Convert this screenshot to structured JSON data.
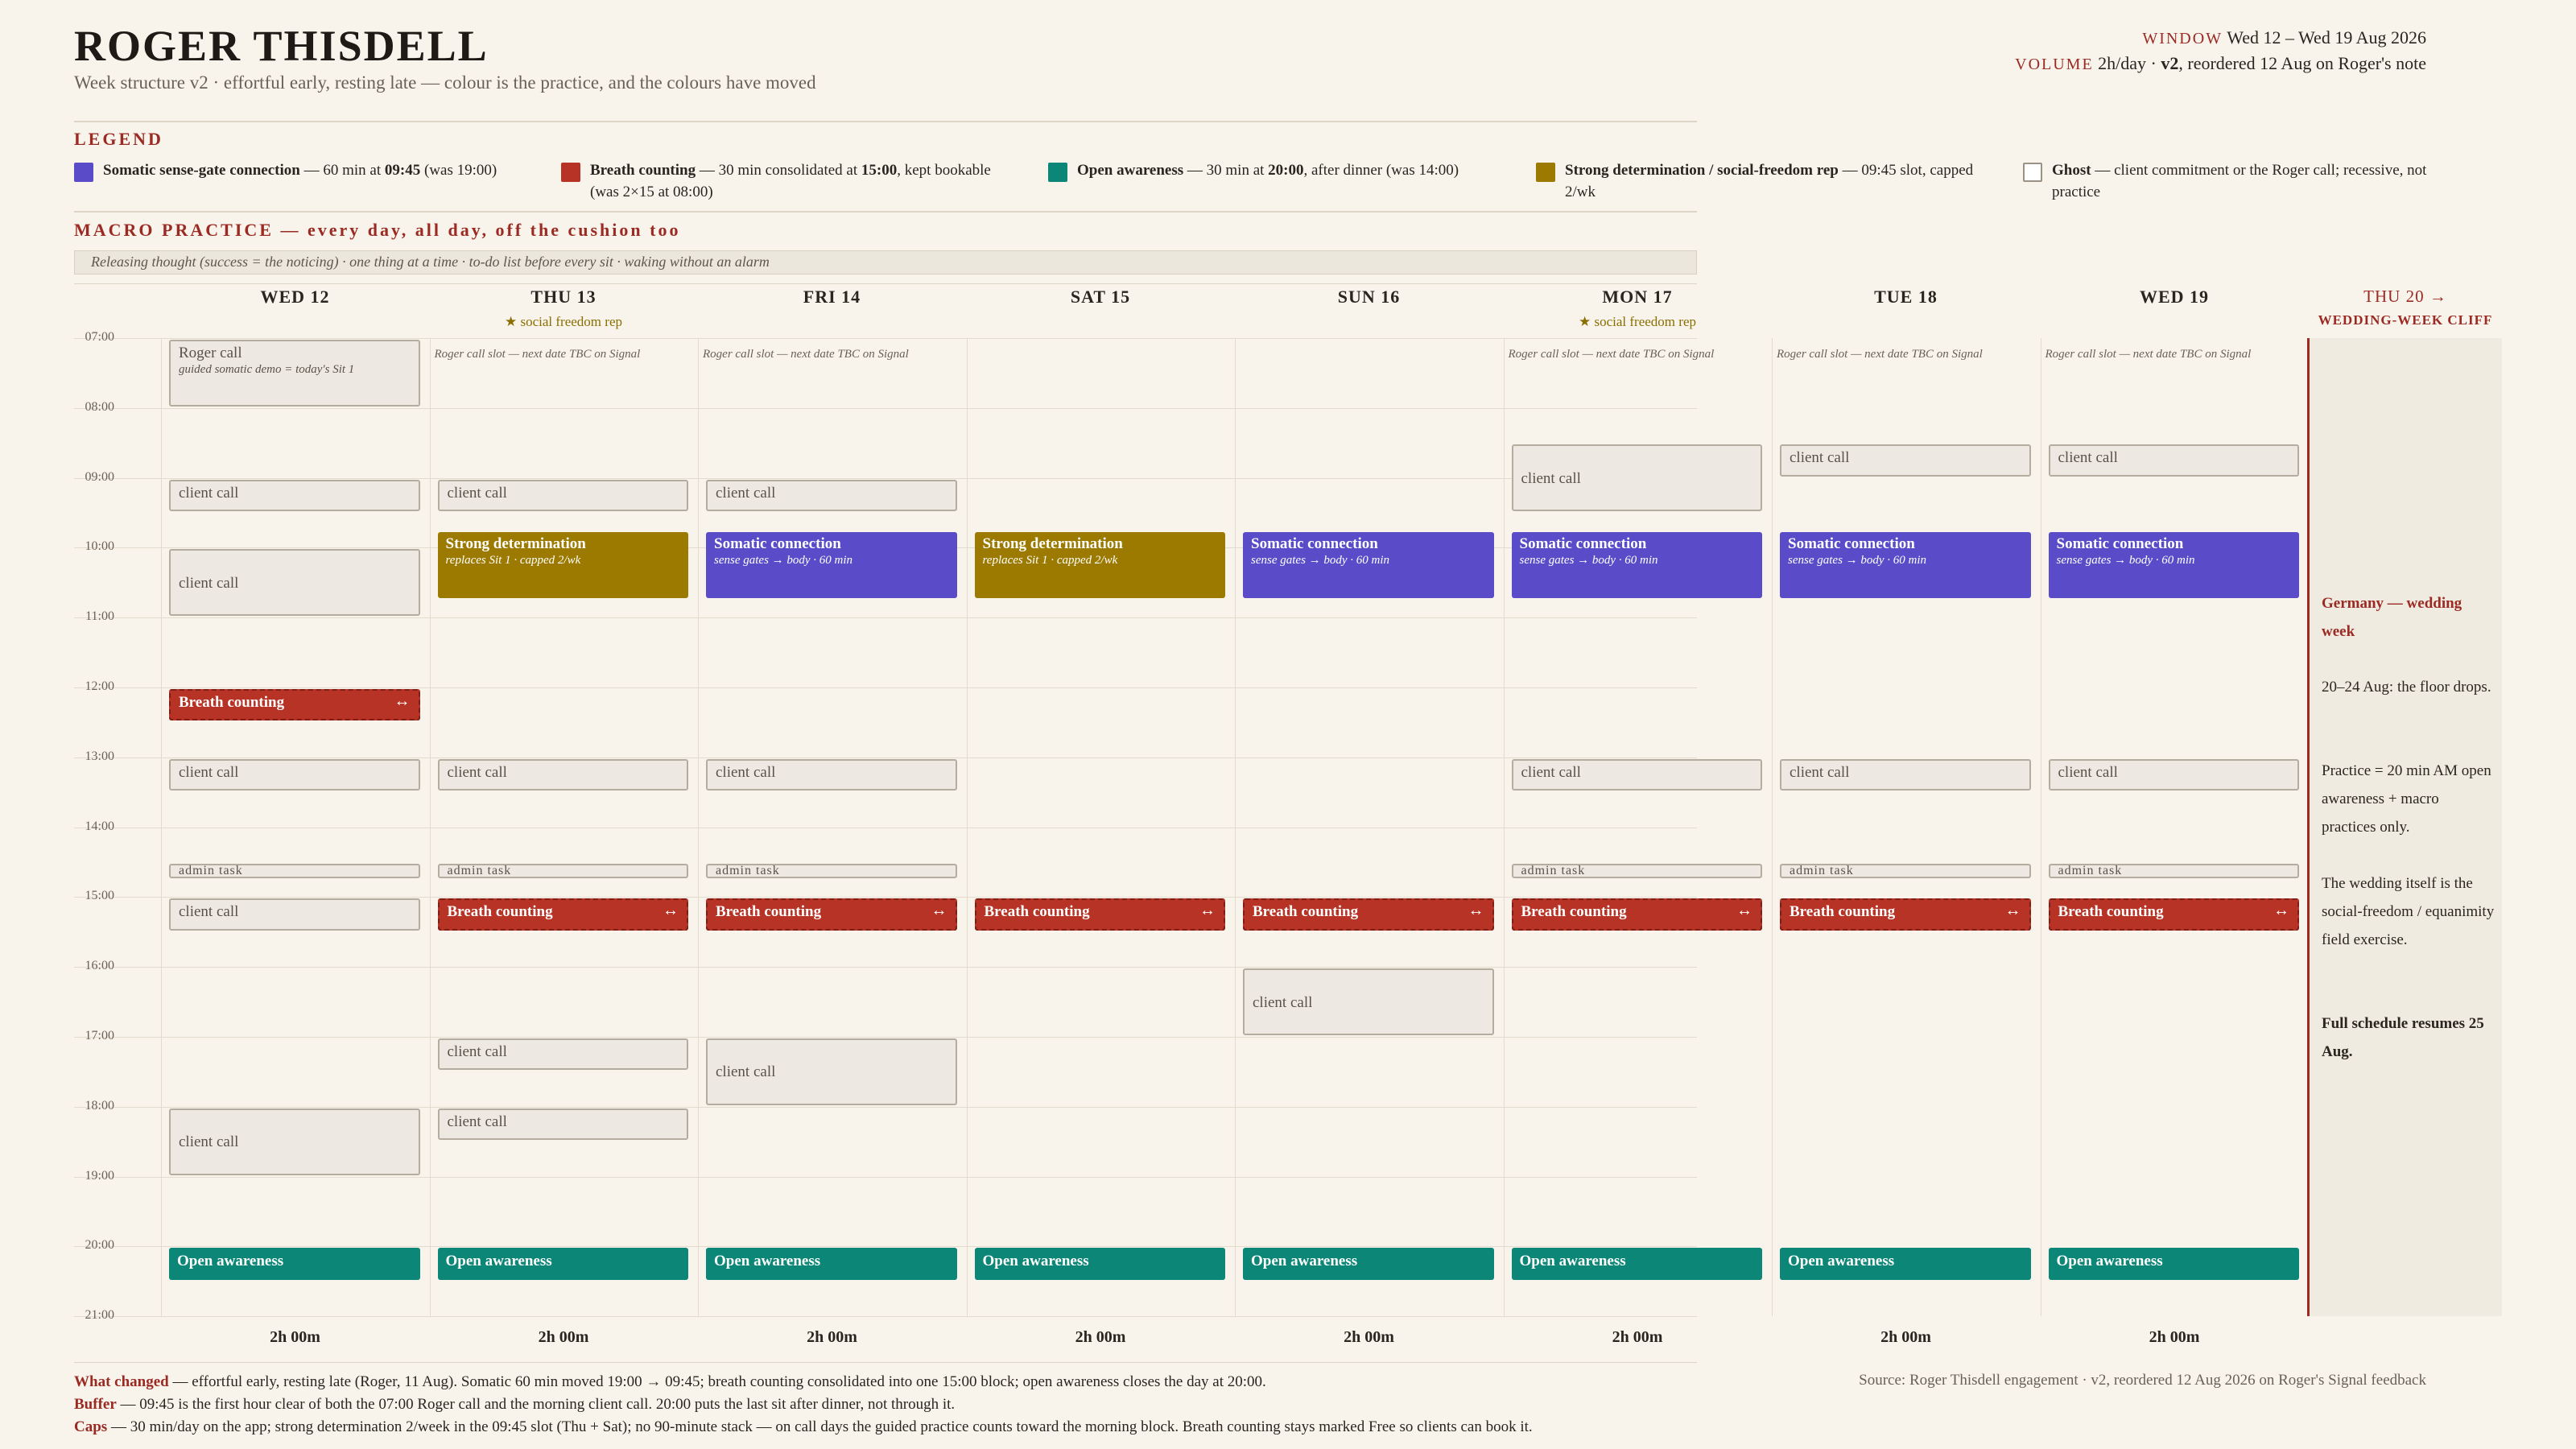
{
  "header": {
    "title": "ROGER THISDELL",
    "subtitle": "Week structure v2 · effortful early, resting late — colour is the practice, and the colours have moved",
    "window_label": "WINDOW",
    "window_value": "Wed 12 – Wed 19 Aug 2026",
    "volume_label": "VOLUME",
    "volume_value_a": "2h/day · ",
    "volume_value_b": "v2",
    "volume_value_c": ", reordered 12 Aug on Roger's note"
  },
  "legend": {
    "heading": "LEGEND",
    "items": [
      {
        "name": "Somatic sense-gate connection",
        "desc_a": " — 60 min at ",
        "time": "09:45",
        "desc_b": " (was 19:00)",
        "color": "#5a4cc8"
      },
      {
        "name": "Breath counting",
        "desc_a": " — 30 min consolidated at ",
        "time": "15:00",
        "desc_b": ", kept bookable (was 2×15 at 08:00)",
        "color": "#b73325"
      },
      {
        "name": "Open awareness",
        "desc_a": " — 30 min at ",
        "time": "20:00",
        "desc_b": ", after dinner (was 14:00)",
        "color": "#0b8677"
      },
      {
        "name": "Strong determination / social-freedom rep",
        "desc_a": " — 09:45 slot, capped 2/wk",
        "time": "",
        "desc_b": "",
        "color": "#9c7a00"
      },
      {
        "name": "Ghost",
        "desc_a": " — client commitment or the Roger call; recessive, not practice",
        "time": "",
        "desc_b": "",
        "color": "#ffffff"
      }
    ]
  },
  "macro": {
    "heading": "MACRO PRACTICE — every day, all day, off the cushion too",
    "text": "Releasing thought (success = the noticing) · one thing at a time · to-do list before every sit · waking without an alarm"
  },
  "hours": [
    "07:00",
    "08:00",
    "09:00",
    "10:00",
    "11:00",
    "12:00",
    "13:00",
    "14:00",
    "15:00",
    "16:00",
    "17:00",
    "18:00",
    "19:00",
    "20:00",
    "21:00"
  ],
  "days": [
    {
      "label": "WED 12",
      "tag": "",
      "total": "2h 00m"
    },
    {
      "label": "THU 13",
      "tag": "★ social freedom rep",
      "total": "2h 00m"
    },
    {
      "label": "FRI 14",
      "tag": "",
      "total": "2h 00m"
    },
    {
      "label": "SAT 15",
      "tag": "",
      "total": "2h 00m"
    },
    {
      "label": "SUN 16",
      "tag": "",
      "total": "2h 00m"
    },
    {
      "label": "MON 17",
      "tag": "★ social freedom rep",
      "total": "2h 00m"
    },
    {
      "label": "TUE 18",
      "tag": "",
      "total": "2h 00m"
    },
    {
      "label": "WED 19",
      "tag": "",
      "total": "2h 00m"
    }
  ],
  "labels": {
    "client_call": "client call",
    "admin_task": "admin task",
    "roger_call": "Roger call",
    "roger_call_sub": "guided somatic demo = today's Sit 1",
    "roger_slot": "Roger call slot — next date TBC on Signal",
    "somatic": "Somatic connection",
    "somatic_sub": "sense gates → body · 60 min",
    "strong": "Strong determination",
    "strong_sub": "replaces Sit 1 · capped 2/wk",
    "breath": "Breath counting",
    "breath_arrow": "↔",
    "open": "Open awareness"
  },
  "cliff": {
    "head": "THU 20 →",
    "sub": "WEDDING-WEEK CLIFF",
    "n1": "Germany — wedding week",
    "n2": "20–24 Aug: the floor drops.",
    "n3": "Practice = 20 min AM open awareness + macro practices only.",
    "n4": "The wedding itself is the social-freedom / equanimity field exercise.",
    "n5": "Full schedule resumes 25 Aug."
  },
  "footer": {
    "changed_k": "What changed",
    "changed_v": " — effortful early, resting late (Roger, 11 Aug). Somatic 60 min moved 19:00 → 09:45; breath counting consolidated into one 15:00 block; open awareness closes the day at 20:00.",
    "buffer_k": "Buffer",
    "buffer_v": " — 09:45 is the first hour clear of both the 07:00 Roger call and the morning client call. 20:00 puts the last sit after dinner, not through it.",
    "caps_k": "Caps",
    "caps_v": " — 30 min/day on the app; strong determination 2/week in the 09:45 slot (Thu + Sat); no 90-minute stack — on call days the guided practice counts toward the morning block. Breath counting stays marked Free so clients can book it.",
    "source": "Source: Roger Thisdell engagement · v2, reordered 12 Aug 2026 on Roger's Signal feedback"
  },
  "colors": {
    "accent": "#9b2a22",
    "somatic": "#5a4cc8",
    "breath": "#b73325",
    "open": "#0b8677",
    "strong": "#9c7a00"
  }
}
